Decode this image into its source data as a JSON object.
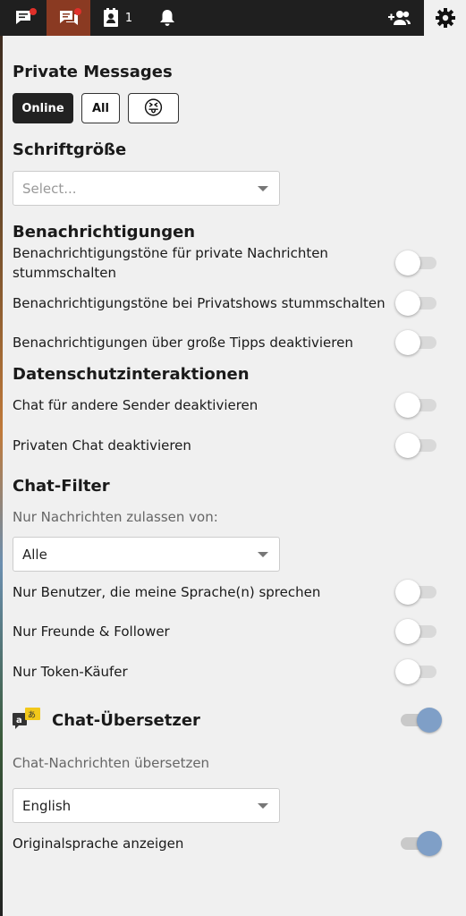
{
  "topbar": {
    "contacts_count": "1"
  },
  "private_messages": {
    "heading": "Private Messages",
    "buttons": {
      "online": "Online",
      "all": "All",
      "emoji": "😝"
    }
  },
  "font_size": {
    "heading": "Schriftgröße",
    "select_placeholder": "Select..."
  },
  "notifications": {
    "heading": "Benachrichtigungen",
    "items": [
      {
        "label_line1": "Benachrichtigungstöne für private Nachrichten",
        "label_line2": "stummschalten",
        "enabled": false
      },
      {
        "label": "Benachrichtigungstöne bei Privatshows stummschalten",
        "enabled": false
      },
      {
        "label": "Benachrichtigungen über große Tipps deaktivieren",
        "enabled": false
      }
    ]
  },
  "privacy": {
    "heading": "Datenschutzinteraktionen",
    "items": [
      {
        "label": "Chat für andere Sender deaktivieren",
        "enabled": false
      },
      {
        "label": "Privaten Chat deaktivieren",
        "enabled": false
      }
    ]
  },
  "chat_filter": {
    "heading": "Chat-Filter",
    "sublabel": "Nur Nachrichten zulassen von:",
    "select_value": "Alle",
    "items": [
      {
        "label": "Nur Benutzer, die meine Sprache(n) sprechen",
        "enabled": false
      },
      {
        "label": "Nur Freunde & Follower",
        "enabled": false
      },
      {
        "label": "Nur Token-Käufer",
        "enabled": false
      }
    ]
  },
  "translator": {
    "heading": "Chat-Übersetzer",
    "enabled": true,
    "sublabel": "Chat-Nachrichten übersetzen",
    "select_value": "English",
    "show_original_label": "Originalsprache anzeigen",
    "show_original_enabled": true
  },
  "colors": {
    "topbar_bg": "#1f1f1f",
    "active_tab": "#8a3a22",
    "badge_dot": "#e0302a",
    "toggle_on": "#7f9fc7"
  },
  "icons": [
    "chat-icon",
    "private-messages-icon",
    "contacts-icon",
    "bell-icon",
    "add-user-icon",
    "gear-icon",
    "translate-icon",
    "caret-down-icon"
  ]
}
